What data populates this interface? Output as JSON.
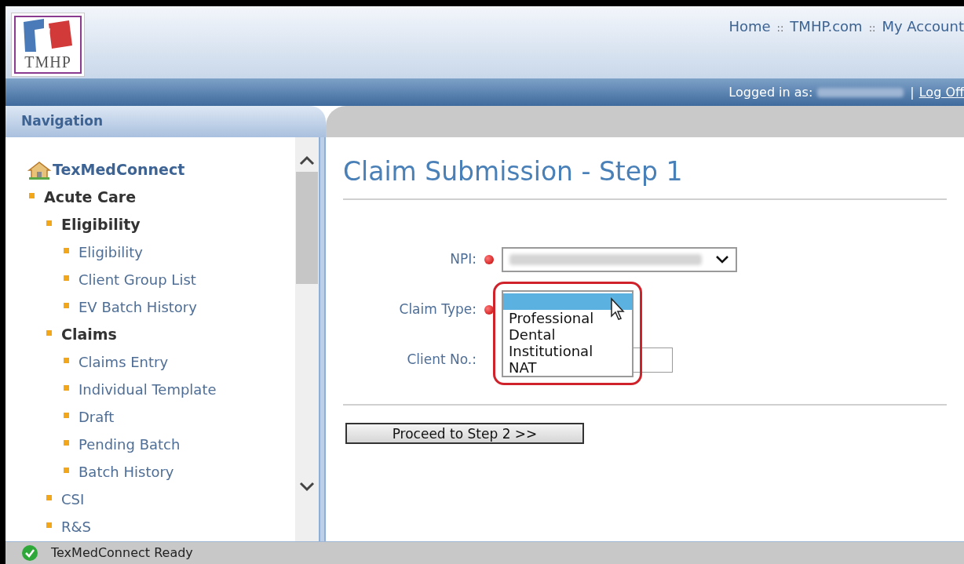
{
  "header": {
    "logo_text": "TMHP",
    "links": [
      "Home",
      "TMHP.com",
      "My Account"
    ],
    "link_separator": "::",
    "logged_in_label": "Logged in as:",
    "log_off": "Log Off",
    "log_off_separator": "|"
  },
  "navigation": {
    "title": "Navigation",
    "tree": [
      {
        "label": "TexMedConnect",
        "kind": "home",
        "children": [
          {
            "label": "Acute Care",
            "kind": "group",
            "children": [
              {
                "label": "Eligibility",
                "kind": "group",
                "children": [
                  {
                    "label": "Eligibility",
                    "kind": "link"
                  },
                  {
                    "label": "Client Group List",
                    "kind": "link"
                  },
                  {
                    "label": "EV Batch History",
                    "kind": "link"
                  }
                ]
              },
              {
                "label": "Claims",
                "kind": "group",
                "children": [
                  {
                    "label": "Claims Entry",
                    "kind": "link"
                  },
                  {
                    "label": "Individual Template",
                    "kind": "link"
                  },
                  {
                    "label": "Draft",
                    "kind": "link"
                  },
                  {
                    "label": "Pending Batch",
                    "kind": "link"
                  },
                  {
                    "label": "Batch History",
                    "kind": "link"
                  }
                ]
              },
              {
                "label": "CSI",
                "kind": "link"
              },
              {
                "label": "R&S",
                "kind": "link"
              }
            ]
          }
        ]
      }
    ]
  },
  "main": {
    "title": "Claim Submission - Step 1",
    "fields": [
      {
        "label": "NPI:",
        "kind": "select",
        "required": true
      },
      {
        "label": "Claim Type:",
        "kind": "listbox",
        "required": true,
        "blank_option_highlighted": true,
        "options": [
          {
            "label": "Professional",
            "selected": false
          },
          {
            "label": "Dental",
            "selected": false
          },
          {
            "label": "Institutional",
            "selected": false
          },
          {
            "label": "NAT",
            "selected": false
          }
        ]
      },
      {
        "label": "Client No.:",
        "kind": "input",
        "required": false
      }
    ],
    "proceed_button": "Proceed to Step 2 >>"
  },
  "status_bar": {
    "text": "TexMedConnect Ready"
  }
}
